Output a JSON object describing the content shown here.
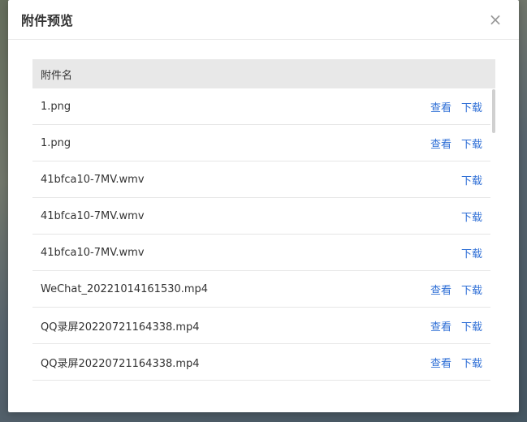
{
  "modal": {
    "title": "附件预览",
    "close_symbol": "×"
  },
  "table": {
    "header": "附件名",
    "view_label": "查看",
    "download_label": "下载",
    "rows": [
      {
        "name": "1.png",
        "viewable": true
      },
      {
        "name": "1.png",
        "viewable": true
      },
      {
        "name": "41bfca10-7MV.wmv",
        "viewable": false
      },
      {
        "name": "41bfca10-7MV.wmv",
        "viewable": false
      },
      {
        "name": "41bfca10-7MV.wmv",
        "viewable": false
      },
      {
        "name": "WeChat_20221014161530.mp4",
        "viewable": true
      },
      {
        "name": "QQ录屏20220721164338.mp4",
        "viewable": true
      },
      {
        "name": "QQ录屏20220721164338.mp4",
        "viewable": true
      },
      {
        "name": "",
        "viewable": false
      }
    ]
  }
}
